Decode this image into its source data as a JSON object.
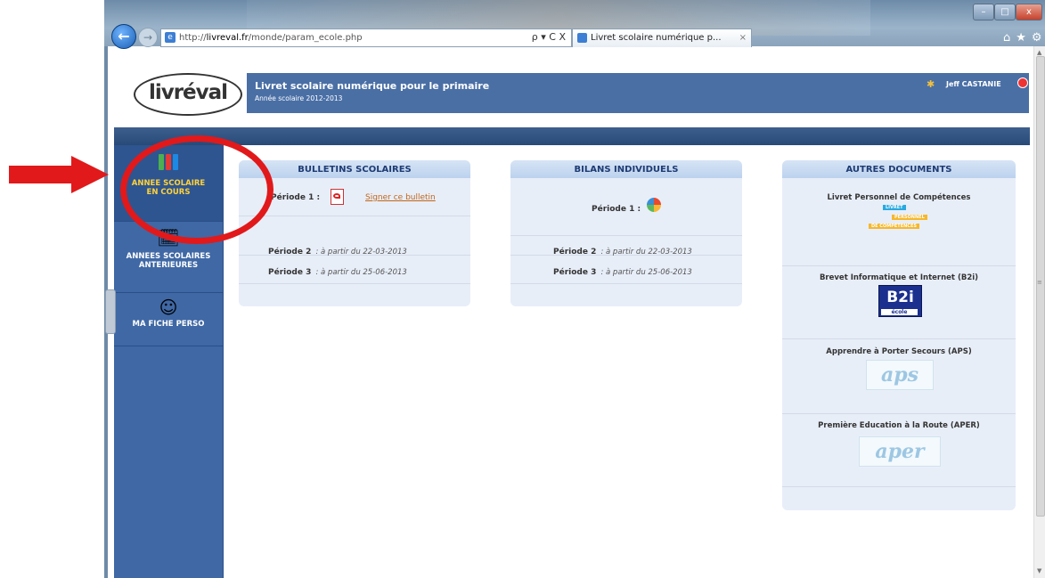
{
  "browser": {
    "url_prefix": "http://",
    "url_host": "livreval.fr",
    "url_path": "/monde/param_ecole.php",
    "tab_title": "Livret scolaire numérique p...",
    "addr_tools": "ρ ▾ C X",
    "tab_close": "×"
  },
  "header": {
    "logo_text": "livréval",
    "title": "Livret scolaire numérique pour le primaire",
    "subtitle": "Année scolaire 2012-2013",
    "user": "Jeff CASTANIE"
  },
  "sidebar": {
    "items": [
      {
        "label_line1": "ANNEE SCOLAIRE",
        "label_line2": "EN COURS",
        "active": true
      },
      {
        "label_line1": "ANNEES SCOLAIRES",
        "label_line2": "ANTERIEURES",
        "active": false
      },
      {
        "label_line1": "MA FICHE PERSO",
        "label_line2": "",
        "active": false
      }
    ]
  },
  "bulletins": {
    "title": "BULLETINS SCOLAIRES",
    "p1_label": "Période 1 :",
    "p1_link": "Signer ce bulletin",
    "p2_label": "Période 2",
    "p2_date": ": à partir du 22-03-2013",
    "p3_label": "Période 3",
    "p3_date": ": à partir du 25-06-2013"
  },
  "bilans": {
    "title": "BILANS INDIVIDUELS",
    "p1_label": "Période 1 :",
    "p2_label": "Période 2",
    "p2_date": ": à partir du 22-03-2013",
    "p3_label": "Période 3",
    "p3_date": ": à partir du 25-06-2013"
  },
  "autres": {
    "title": "AUTRES DOCUMENTS",
    "docs": [
      {
        "title": "Livret Personnel de Compétences",
        "logo_lines": [
          "LIVRET",
          "PERSONNEL",
          "DE COMPÉTENCES"
        ]
      },
      {
        "title": "Brevet Informatique et Internet (B2i)",
        "logo_text": "B2i",
        "logo_sub": "école"
      },
      {
        "title": "Apprendre à Porter Secours (APS)",
        "logo_text": "aps"
      },
      {
        "title": "Première Education à la Route (APER)",
        "logo_text": "aper"
      }
    ]
  },
  "colors": {
    "header_blue": "#4a6fa5",
    "sidebar_blue": "#3f68a5",
    "annotation_red": "#e1191b",
    "active_label": "#ffd23a"
  }
}
